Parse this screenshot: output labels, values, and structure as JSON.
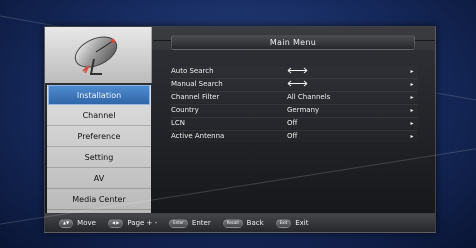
{
  "menu": {
    "title": "Main Menu"
  },
  "sidebar": {
    "items": [
      {
        "label": "Installation"
      },
      {
        "label": "Channel"
      },
      {
        "label": "Preference"
      },
      {
        "label": "Setting"
      },
      {
        "label": "AV"
      },
      {
        "label": "Media Center"
      }
    ]
  },
  "installation": {
    "rows": [
      {
        "label": "Auto Search",
        "value": "",
        "arrow": "▸"
      },
      {
        "label": "Manual Search",
        "value": "",
        "arrow": "▸"
      },
      {
        "label": "Channel Filter",
        "value": "All Channels",
        "arrow": "▸"
      },
      {
        "label": "Country",
        "value": "Germany",
        "arrow": "▸"
      },
      {
        "label": "LCN",
        "value": "Off",
        "arrow": "▸"
      },
      {
        "label": "Active Antenna",
        "value": "Off",
        "arrow": "▸"
      }
    ]
  },
  "footer": {
    "items": [
      {
        "key": "▲▼",
        "label": "Move"
      },
      {
        "key": "◀ ▶",
        "label": "Page + -"
      },
      {
        "key": "Enter",
        "label": "Enter"
      },
      {
        "key": "Recall",
        "label": "Back"
      },
      {
        "key": "Exit",
        "label": "Exit"
      }
    ]
  },
  "icons": {
    "logo": "satellite-dish-icon",
    "return_arrow": "return-arrow-icon",
    "submenu_arrow": "chevron-right-icon"
  },
  "colors": {
    "active_tab": "#3f78bf",
    "panel_bg": "#1f2024",
    "sidebar_bg": "#d9d9d9"
  }
}
